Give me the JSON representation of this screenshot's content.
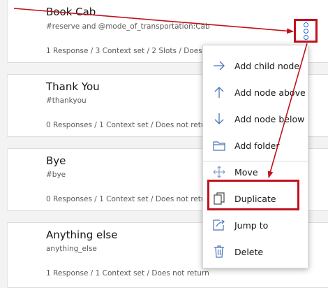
{
  "nodes": [
    {
      "title": "Book Cab",
      "condition": "#reserve and @mode_of_transportation:Cab",
      "meta": "1 Response / 3 Context set / 2 Slots / Does"
    },
    {
      "title": "Thank You",
      "condition": "#thankyou",
      "meta": "0 Responses / 1 Context set / Does not retu"
    },
    {
      "title": "Bye",
      "condition": "#bye",
      "meta": "0 Responses / 1 Context set / Does not retu"
    },
    {
      "title": "Anything else",
      "condition": "anything_else",
      "meta": "1 Response / 1 Context set / Does not return"
    }
  ],
  "menu": {
    "items": [
      {
        "label": "Add child node",
        "icon": "arrow-right-icon"
      },
      {
        "label": "Add node above",
        "icon": "arrow-up-icon"
      },
      {
        "label": "Add node below",
        "icon": "arrow-down-icon"
      },
      {
        "label": "Add folder",
        "icon": "folder-icon"
      },
      {
        "label": "Move",
        "icon": "move-icon"
      },
      {
        "label": "Duplicate",
        "icon": "duplicate-icon"
      },
      {
        "label": "Jump to",
        "icon": "jump-to-icon"
      },
      {
        "label": "Delete",
        "icon": "trash-icon"
      }
    ]
  },
  "colors": {
    "annotation": "#c1121f",
    "icon_blue": "#1f66d6",
    "menu_icon": "#4a73b8"
  }
}
